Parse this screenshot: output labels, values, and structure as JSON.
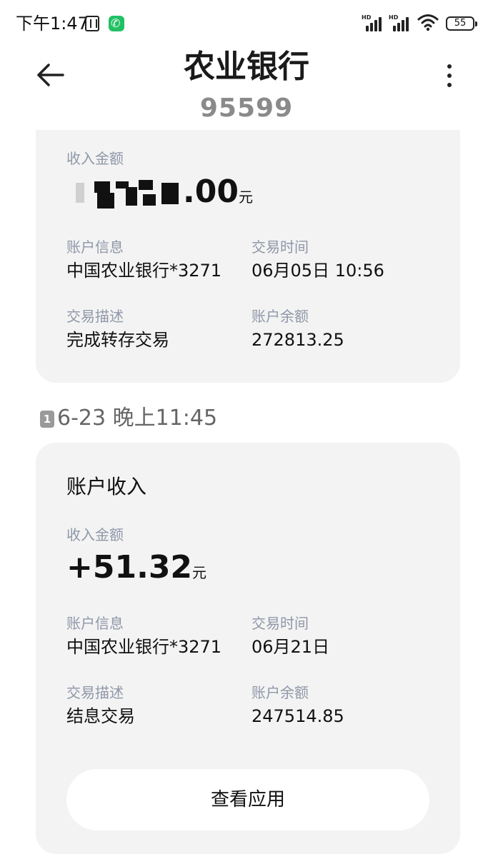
{
  "status_bar": {
    "time": "下午1:47",
    "sim1_hd": "HD",
    "sim2_hd": "HD",
    "battery": "55",
    "icons": [
      "nfc-icon",
      "call-icon",
      "signal-icon",
      "signal-icon",
      "wifi-icon",
      "battery-icon"
    ]
  },
  "header": {
    "title": "农业银行",
    "subtitle": "95599"
  },
  "message1": {
    "amount_label": "收入金额",
    "amount_suffix": ".00",
    "amount_unit": "元",
    "amount_obscured": true,
    "account_label": "账户信息",
    "account_value": "中国农业银行*3271",
    "time_label": "交易时间",
    "time_value": "06月05日 10:56",
    "desc_label": "交易描述",
    "desc_value": "完成转存交易",
    "balance_label": "账户余额",
    "balance_value": "272813.25"
  },
  "separator": {
    "sim": "1",
    "text": "6-23 晚上11:45"
  },
  "message2": {
    "heading": "账户收入",
    "amount_label": "收入金额",
    "amount": "+51.32",
    "amount_unit": "元",
    "account_label": "账户信息",
    "account_value": "中国农业银行*3271",
    "time_label": "交易时间",
    "time_value": "06月21日",
    "desc_label": "交易描述",
    "desc_value": "结息交易",
    "balance_label": "账户余额",
    "balance_value": "247514.85",
    "button_label": "查看应用"
  },
  "colors": {
    "card_bg": "#f3f3f3",
    "label": "#8f97a8",
    "subtitle": "#8a8a8a",
    "call_green": "#22c064"
  }
}
